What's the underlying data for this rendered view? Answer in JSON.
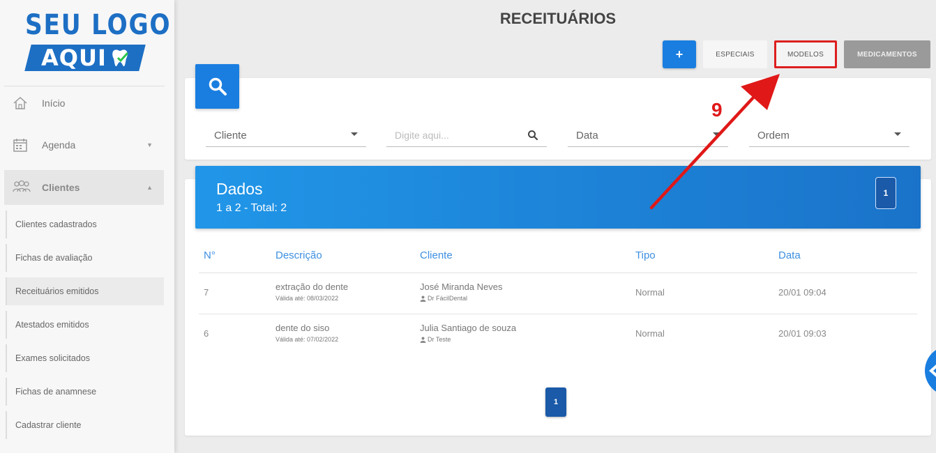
{
  "logo": {
    "line1": "SEU LOGO",
    "line2": "AQUI"
  },
  "sidebar": {
    "items": [
      {
        "label": "Início",
        "icon": "home-icon"
      },
      {
        "label": "Agenda",
        "icon": "calendar-icon"
      },
      {
        "label": "Clientes",
        "icon": "users-icon"
      }
    ],
    "sub_items": [
      "Clientes cadastrados",
      "Fichas de avaliação",
      "Receituários emitidos",
      "Atestados emitidos",
      "Exames solicitados",
      "Fichas de anamnese",
      "Cadastrar cliente"
    ]
  },
  "header": {
    "title": "RECEITUÁRIOS",
    "add_label": "+",
    "tabs": {
      "especiais": "ESPECIAIS",
      "modelos": "MODELOS",
      "medicamentos": "MEDICAMENTOS"
    }
  },
  "filters": {
    "cliente": "Cliente",
    "search_placeholder": "Digite aqui...",
    "data": "Data",
    "ordem": "Ordem"
  },
  "data_panel": {
    "title": "Dados",
    "subtitle": "1 a 2 - Total: 2",
    "page": "1"
  },
  "table": {
    "headers": {
      "num": "N°",
      "descricao": "Descrição",
      "cliente": "Cliente",
      "tipo": "Tipo",
      "data": "Data"
    },
    "rows": [
      {
        "num": "7",
        "descricao": "extração do dente",
        "validade": "Válida até: 08/03/2022",
        "cliente": "José Miranda Neves",
        "doutor": "Dr FácilDental",
        "tipo": "Normal",
        "data": "20/01 09:04"
      },
      {
        "num": "6",
        "descricao": "dente do siso",
        "validade": "Válida até: 07/02/2022",
        "cliente": "Julia Santiago de souza",
        "doutor": "Dr Teste",
        "tipo": "Normal",
        "data": "20/01 09:03"
      }
    ]
  },
  "pagination": {
    "current": "1"
  },
  "annotation": {
    "step": "9"
  },
  "colors": {
    "primary": "#1a7ee0",
    "highlight": "#dd1f1f",
    "dark_blue": "#1a5aa8"
  }
}
